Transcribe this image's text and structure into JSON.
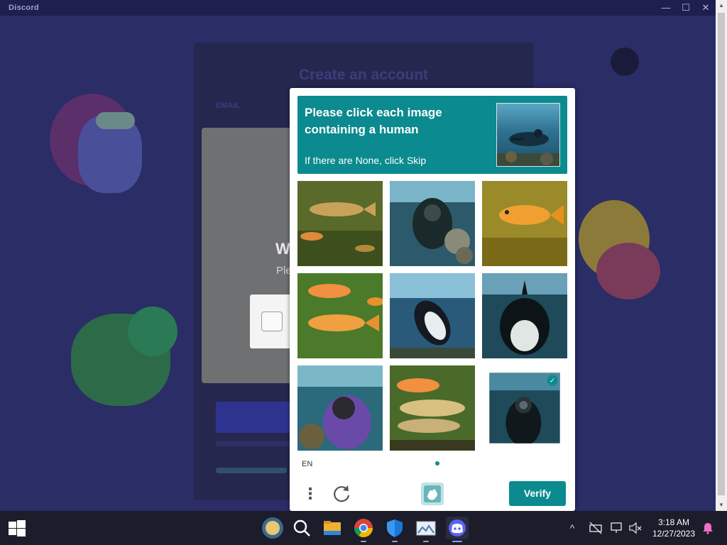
{
  "window": {
    "title": "Discord",
    "controls": {
      "minimize": "—",
      "maximize": "☐",
      "close": "✕"
    }
  },
  "register": {
    "title": "Create an account",
    "email_label": "EMAIL"
  },
  "modal": {
    "heading_fragment": "W",
    "text_fragment": "Ple"
  },
  "captcha": {
    "prompt": "Please click each image containing a human",
    "sub": "If there are None, click Skip",
    "language": "EN",
    "more_icon": "⋮",
    "verify_label": "Verify",
    "tiles": [
      {
        "id": "fish-1",
        "subject": "fish",
        "selected": false
      },
      {
        "id": "diver-1",
        "subject": "human",
        "selected": false
      },
      {
        "id": "fish-2",
        "subject": "fish",
        "selected": false
      },
      {
        "id": "fish-3",
        "subject": "fish",
        "selected": false
      },
      {
        "id": "penguin-1",
        "subject": "penguin",
        "selected": false
      },
      {
        "id": "orca-1",
        "subject": "orca",
        "selected": false
      },
      {
        "id": "diver-2",
        "subject": "human",
        "selected": false
      },
      {
        "id": "fish-4",
        "subject": "fish",
        "selected": false
      },
      {
        "id": "diver-3",
        "subject": "human",
        "selected": true
      }
    ],
    "check_icon": "✓",
    "accent": "#0b8a8f"
  },
  "taskbar": {
    "apps": [
      "start-icon",
      "shell-icon",
      "search-icon",
      "file-explorer-icon",
      "chrome-icon",
      "defender-icon",
      "photos-icon",
      "discord-icon"
    ],
    "tray": {
      "chevron": "^",
      "time": "3:18 AM",
      "date": "12/27/2023"
    }
  }
}
